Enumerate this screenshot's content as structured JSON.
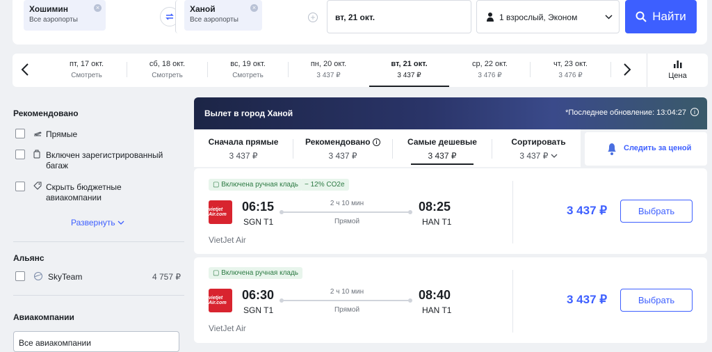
{
  "search": {
    "from_city": "Хошимин",
    "from_sub": "Все аэропорты",
    "to_city": "Ханой",
    "to_sub": "Все аэропорты",
    "date": "вт, 21 окт.",
    "passengers": "1 взрослый, Эконом",
    "find_label": "Найти"
  },
  "dates": [
    {
      "day": "пт, 17 окт.",
      "price": "Смотреть"
    },
    {
      "day": "сб, 18 окт.",
      "price": "Смотреть"
    },
    {
      "day": "вс, 19 окт.",
      "price": "Смотреть"
    },
    {
      "day": "пн, 20 окт.",
      "price": "3 437 ₽"
    },
    {
      "day": "вт, 21 окт.",
      "price": "3 437 ₽"
    },
    {
      "day": "ср, 22 окт.",
      "price": "3 476 ₽"
    },
    {
      "day": "чт, 23 окт.",
      "price": "3 476 ₽"
    }
  ],
  "price_chart_label": "Цена",
  "sidebar": {
    "recommended_title": "Рекомендовано",
    "options": [
      "Прямые",
      "Включен зарегистрированный багаж",
      "Скрыть бюджетные авиакомпании"
    ],
    "expand_label": "Развернуть",
    "alliance_title": "Альянс",
    "alliance_name": "SkyTeam",
    "alliance_price": "4 757 ₽",
    "airlines_title": "Авиакомпании",
    "airlines_select": "Все авиакомпании"
  },
  "banner": {
    "title": "Вылет в город Ханой",
    "updated": "*Последнее обновление: 13:04:27"
  },
  "sort_tabs": [
    {
      "label": "Сначала прямые",
      "price": "3 437 ₽"
    },
    {
      "label": "Рекомендовано",
      "price": "3 437 ₽"
    },
    {
      "label": "Самые дешевые",
      "price": "3 437 ₽"
    },
    {
      "label": "Сортировать",
      "price": "3 437 ₽"
    }
  ],
  "price_watch_label": "Следить за ценой",
  "flights": [
    {
      "badge": "Включена ручная кладь",
      "eco_badge": "− 12% CO2e",
      "dep_time": "06:15",
      "dep_ap": "SGN T1",
      "arr_time": "08:25",
      "arr_ap": "HAN T1",
      "duration": "2 ч 10 мин",
      "type": "Прямой",
      "airline": "VietJet Air",
      "logo": "vietjet Air.com",
      "price": "3 437 ₽",
      "choose": "Выбрать"
    },
    {
      "badge": "Включена ручная кладь",
      "dep_time": "06:30",
      "dep_ap": "SGN T1",
      "arr_time": "08:40",
      "arr_ap": "HAN T1",
      "duration": "2 ч 10 мин",
      "type": "Прямой",
      "airline": "VietJet Air",
      "logo": "vietjet Air.com",
      "price": "3 437 ₽",
      "choose": "Выбрать"
    }
  ]
}
